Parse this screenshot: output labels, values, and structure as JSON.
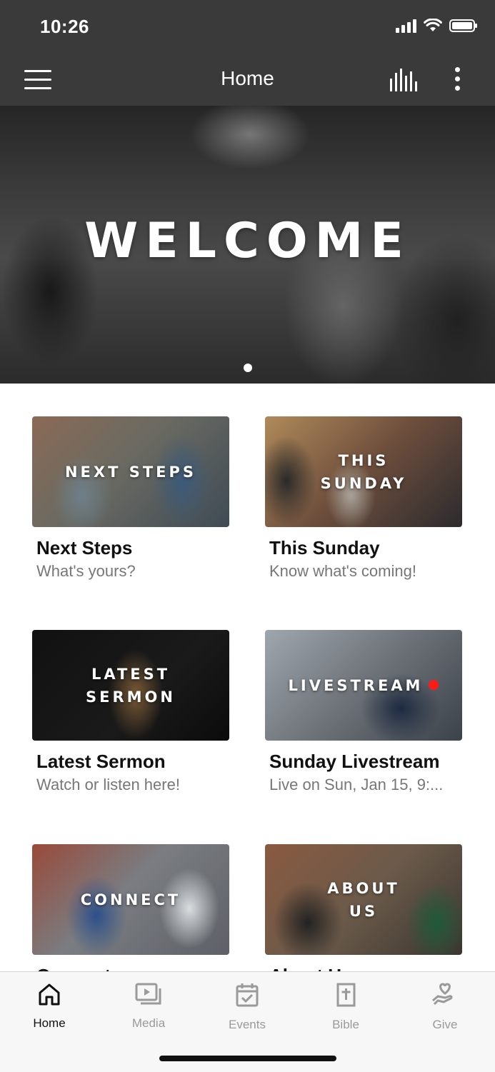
{
  "status_bar": {
    "time": "10:26"
  },
  "navbar": {
    "title": "Home"
  },
  "hero": {
    "text": "WELCOME"
  },
  "cards": [
    {
      "image_text": "NEXT STEPS",
      "title": "Next Steps",
      "subtitle": "What's yours?"
    },
    {
      "image_text": "THIS\nSUNDAY",
      "title": "This Sunday",
      "subtitle": "Know what's coming!"
    },
    {
      "image_text": "LATEST\nSERMON",
      "title": "Latest Sermon",
      "subtitle": "Watch or listen here!"
    },
    {
      "image_text": "LIVESTREAM",
      "title": "Sunday Livestream",
      "subtitle": "Live on Sun, Jan 15, 9:..."
    },
    {
      "image_text": "CONNECT",
      "title": "Connect",
      "subtitle": ""
    },
    {
      "image_text": "ABOUT\nUS",
      "title": "About Us",
      "subtitle": ""
    }
  ],
  "tabs": [
    {
      "label": "Home",
      "icon": "home-icon",
      "active": true
    },
    {
      "label": "Media",
      "icon": "media-icon"
    },
    {
      "label": "Events",
      "icon": "calendar-check-icon"
    },
    {
      "label": "Bible",
      "icon": "bible-icon"
    },
    {
      "label": "Give",
      "icon": "give-icon"
    }
  ],
  "colors": {
    "bar_background": "#3a3a3a",
    "live_indicator": "#ff1a1a",
    "tab_active": "#111111",
    "tab_inactive": "#9a9a9a"
  }
}
